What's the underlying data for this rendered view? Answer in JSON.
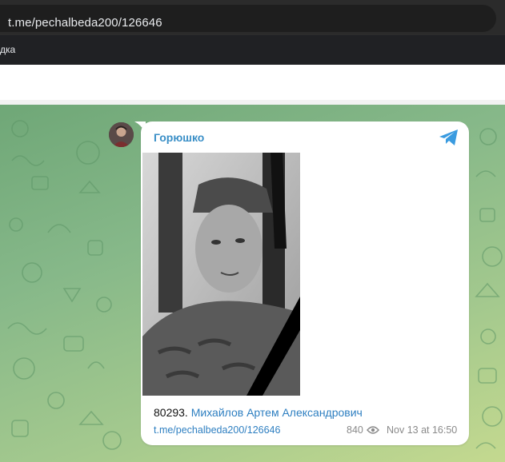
{
  "browser": {
    "url": "t.me/pechalbeda200/126646",
    "bookmark": "дка"
  },
  "post": {
    "author": "Горюшко",
    "caption_number": "80293.",
    "caption_name": "Михайлов Артем Александрович",
    "link": "t.me/pechalbeda200/126646",
    "views": "840",
    "timestamp": "Nov 13 at 16:50"
  },
  "colors": {
    "accent": "#3a8fc7",
    "chat_bg": "#86b889",
    "bubble": "#ffffff"
  },
  "icons": {
    "brand": "telegram-icon",
    "views": "eye-icon"
  }
}
